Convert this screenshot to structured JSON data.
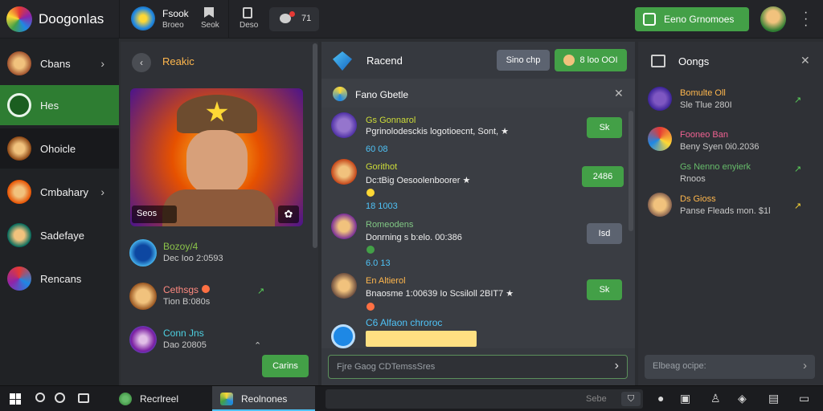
{
  "app": {
    "title": "Doogonlas"
  },
  "topbar": {
    "tab1_title": "Fsook",
    "tab1_sub": "Broeo",
    "tab2_sub": "Seok",
    "tab3_sub": "Deso",
    "badge_count": "71",
    "primary_button": "Eeno Grnomoes"
  },
  "sidebar": {
    "items": [
      {
        "label": "Cbans"
      },
      {
        "label": "Hes"
      },
      {
        "label": "Ohoicle"
      },
      {
        "label": "Cmbahary"
      },
      {
        "label": "Sadefaye"
      },
      {
        "label": "Rencans"
      }
    ]
  },
  "panel_left": {
    "title": "Reakic",
    "card_label": "Seos",
    "entries": [
      {
        "name": "Bozoy/4",
        "sub": "Dec Ioo 2:0593"
      },
      {
        "name": "Cethsgs",
        "sub": "Tion B:080s"
      },
      {
        "name": "Conn Jns",
        "sub": "Dao 20805"
      }
    ],
    "button": "Carins"
  },
  "panel_mid": {
    "title": "Racend",
    "btn_grey": "Sino chp",
    "btn_green": "8 loo OOI",
    "thread_title": "Fano Gbetle",
    "messages": [
      {
        "name": "Gs Gonnarol",
        "text": "Pgrinolodesckis logotioecnt, Sont, ★",
        "meta": "60 08",
        "action": "Sk"
      },
      {
        "name": "Gorithot",
        "text": "Dc:tBig Oesoolenboorer ★",
        "meta": "18 1003",
        "action": "2486"
      },
      {
        "name": "Romeodens",
        "text": "Donrning s b:elo. 00:386",
        "meta": "6.0 13",
        "action": "Isd"
      },
      {
        "name": "En Altierol",
        "text": "Bnaosme 1:00639 Io Scsiloll 2BIT7 ★",
        "meta": "",
        "action": "Sk"
      }
    ],
    "composer_label": "C6 Alfaon chroroc",
    "input_placeholder": "Fjre Gaog CDTemssSres"
  },
  "panel_right": {
    "title": "Oongs",
    "items": [
      {
        "name": "Bomulte Oll",
        "sub": "Sle Tlue 280I"
      },
      {
        "name": "Fooneo Ban",
        "sub": "Beny Syen 0i0.2036"
      },
      {
        "name": "Gs Nenno enyierk",
        "sub": "Rnoos"
      },
      {
        "name": "Ds Gioss",
        "sub": "Panse Fleads mon. $1l"
      }
    ],
    "input_placeholder": "Elbeag ocipe:"
  },
  "taskbar": {
    "task1": "Recrlreel",
    "task2": "Reolnones",
    "search_text": "Sebe"
  },
  "colors": {
    "accent": "#43a047",
    "sidebar_active": "#2e7d32"
  }
}
